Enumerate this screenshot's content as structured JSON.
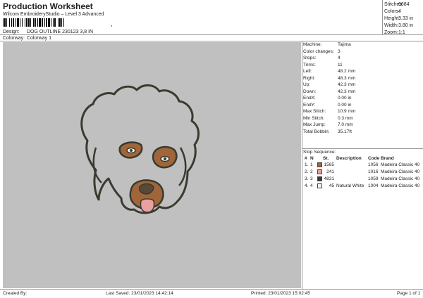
{
  "header": {
    "title": "Production Worksheet",
    "subtitle": "Wilcom EmbroideryStudio – Level 3 Advanced",
    "barcode_suffix": ","
  },
  "meta": {
    "design_label": "Design:",
    "design_value": "DOG OUTLINE 230123 3,8 IN",
    "colorway_label": "Colorway:",
    "colorway_value": "Colorway 1"
  },
  "summary": [
    {
      "label": "Stitches:",
      "value": "6684"
    },
    {
      "label": "Colors:",
      "value": "4"
    },
    {
      "label": "Height:",
      "value": "3.33 in"
    },
    {
      "label": "Width:",
      "value": "3.80 in"
    },
    {
      "label": "Zoom:",
      "value": "1:1"
    }
  ],
  "specs": [
    {
      "label": "Machine:",
      "value": "Tajima"
    },
    {
      "label": "Color changes:",
      "value": "3"
    },
    {
      "label": "Stops:",
      "value": "4"
    },
    {
      "label": "Trims:",
      "value": "11"
    },
    {
      "label": "Left:",
      "value": "48.2 mm"
    },
    {
      "label": "Right:",
      "value": "48.3 mm"
    },
    {
      "label": "Up:",
      "value": "42.3 mm"
    },
    {
      "label": "Down:",
      "value": "42.3 mm"
    },
    {
      "label": "EndX:",
      "value": "0.00 in"
    },
    {
      "label": "EndY:",
      "value": "0.00 in"
    },
    {
      "label": "Max Stitch:",
      "value": "10.9 mm"
    },
    {
      "label": "Min Stitch:",
      "value": "0.3 mm"
    },
    {
      "label": "Max Jump:",
      "value": "7.0 mm"
    },
    {
      "label": "Total Bobbin:",
      "value": "35.17ft"
    }
  ],
  "stop_sequence": {
    "title": "Stop Sequence:",
    "columns": {
      "hash": "#",
      "n": "N",
      "st": "St.",
      "desc": "Description",
      "code": "Code",
      "brand": "Brand"
    },
    "rows": [
      {
        "hash": "1.",
        "n": "1",
        "color": "#a0663a",
        "st": "1565",
        "desc": "",
        "code": "1056",
        "brand": "Madeira Classic 40"
      },
      {
        "hash": "2.",
        "n": "2",
        "color": "#e8a0a0",
        "st": "241",
        "desc": "",
        "code": "1016",
        "brand": "Madeira Classic 40"
      },
      {
        "hash": "3.",
        "n": "3",
        "color": "#3a3a30",
        "st": "4831",
        "desc": "",
        "code": "1059",
        "brand": "Madeira Classic 40"
      },
      {
        "hash": "4.",
        "n": "4",
        "color": "#f4f4ec",
        "st": "45",
        "desc": "Natural White",
        "code": "1004",
        "brand": "Madeira Classic 40"
      }
    ]
  },
  "footer": {
    "created_by": "Created By:",
    "last_saved": "Last Saved: 23/01/2023 14:42:14",
    "printed": "Printed: 23/01/2023 15:02:45",
    "page": "Page 1 of 1"
  },
  "colors": {
    "canvas": "#c0c0c0",
    "outline": "#3a3a30",
    "tan": "#a0663a",
    "tongue": "#e8a0a0"
  }
}
